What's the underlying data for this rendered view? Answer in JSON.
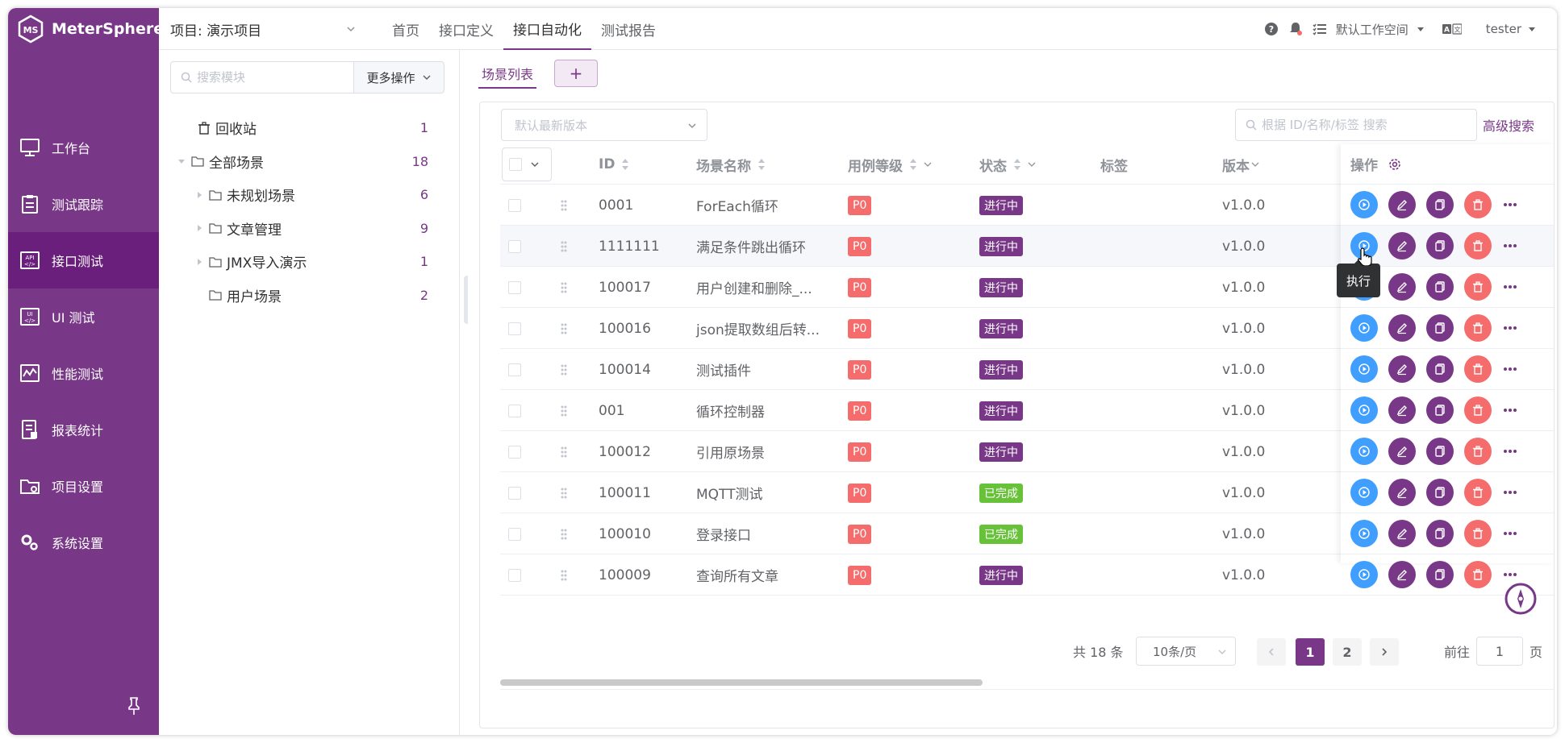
{
  "app": {
    "name": "MeterSphere"
  },
  "colors": {
    "brand": "#783887",
    "danger": "#f56c6c",
    "success": "#67c23a",
    "primary": "#409eff"
  },
  "sidebar": {
    "items": [
      {
        "label": "工作台",
        "icon": "monitor-icon"
      },
      {
        "label": "测试跟踪",
        "icon": "clipboard-icon"
      },
      {
        "label": "接口测试",
        "icon": "api-icon",
        "active": true
      },
      {
        "label": "UI 测试",
        "icon": "ui-icon"
      },
      {
        "label": "性能测试",
        "icon": "performance-icon"
      },
      {
        "label": "报表统计",
        "icon": "report-icon"
      },
      {
        "label": "项目设置",
        "icon": "folder-settings-icon"
      },
      {
        "label": "系统设置",
        "icon": "gears-icon"
      }
    ]
  },
  "header": {
    "project": "项目: 演示项目",
    "nav": [
      "首页",
      "接口定义",
      "接口自动化",
      "测试报告"
    ],
    "workspace": "默认工作空间",
    "user": "tester"
  },
  "tree": {
    "search_placeholder": "搜索模块",
    "more_ops": "更多操作",
    "nodes": [
      {
        "label": "回收站",
        "count": "1"
      },
      {
        "label": "全部场景",
        "count": "18"
      },
      {
        "label": "未规划场景",
        "count": "6"
      },
      {
        "label": "文章管理",
        "count": "9"
      },
      {
        "label": "JMX导入演示",
        "count": "1"
      },
      {
        "label": "用户场景",
        "count": "2"
      }
    ]
  },
  "main": {
    "tab": "场景列表",
    "tab_add": "+",
    "version_placeholder": "默认最新版本",
    "search_placeholder": "根据 ID/名称/标签 搜索",
    "advanced_search": "高级搜索",
    "columns": {
      "id": "ID",
      "name": "场景名称",
      "level": "用例等级",
      "status": "状态",
      "tags": "标签",
      "version": "版本",
      "ops": "操作"
    },
    "rows": [
      {
        "id": "0001",
        "name": "ForEach循环",
        "level": "P0",
        "status": "进行中",
        "version": "v1.0.0"
      },
      {
        "id": "1111111",
        "name": "满足条件跳出循环",
        "level": "P0",
        "status": "进行中",
        "version": "v1.0.0"
      },
      {
        "id": "100017",
        "name": "用户创建和删除_...",
        "level": "P0",
        "status": "进行中",
        "version": "v1.0.0"
      },
      {
        "id": "100016",
        "name": "json提取数组后转...",
        "level": "P0",
        "status": "进行中",
        "version": "v1.0.0"
      },
      {
        "id": "100014",
        "name": "测试插件",
        "level": "P0",
        "status": "进行中",
        "version": "v1.0.0"
      },
      {
        "id": "001",
        "name": "循环控制器",
        "level": "P0",
        "status": "进行中",
        "version": "v1.0.0"
      },
      {
        "id": "100012",
        "name": "引用原场景",
        "level": "P0",
        "status": "进行中",
        "version": "v1.0.0"
      },
      {
        "id": "100011",
        "name": "MQTT测试",
        "level": "P0",
        "status": "已完成",
        "version": "v1.0.0"
      },
      {
        "id": "100010",
        "name": "登录接口",
        "level": "P0",
        "status": "已完成",
        "version": "v1.0.0"
      },
      {
        "id": "100009",
        "name": "查询所有文章",
        "level": "P0",
        "status": "进行中",
        "version": "v1.0.0"
      }
    ],
    "tooltip": "执行"
  },
  "pagination": {
    "total": "共 18 条",
    "page_size": "10条/页",
    "pages": [
      "1",
      "2"
    ],
    "goto_prefix": "前往",
    "goto_value": "1",
    "goto_suffix": "页"
  }
}
